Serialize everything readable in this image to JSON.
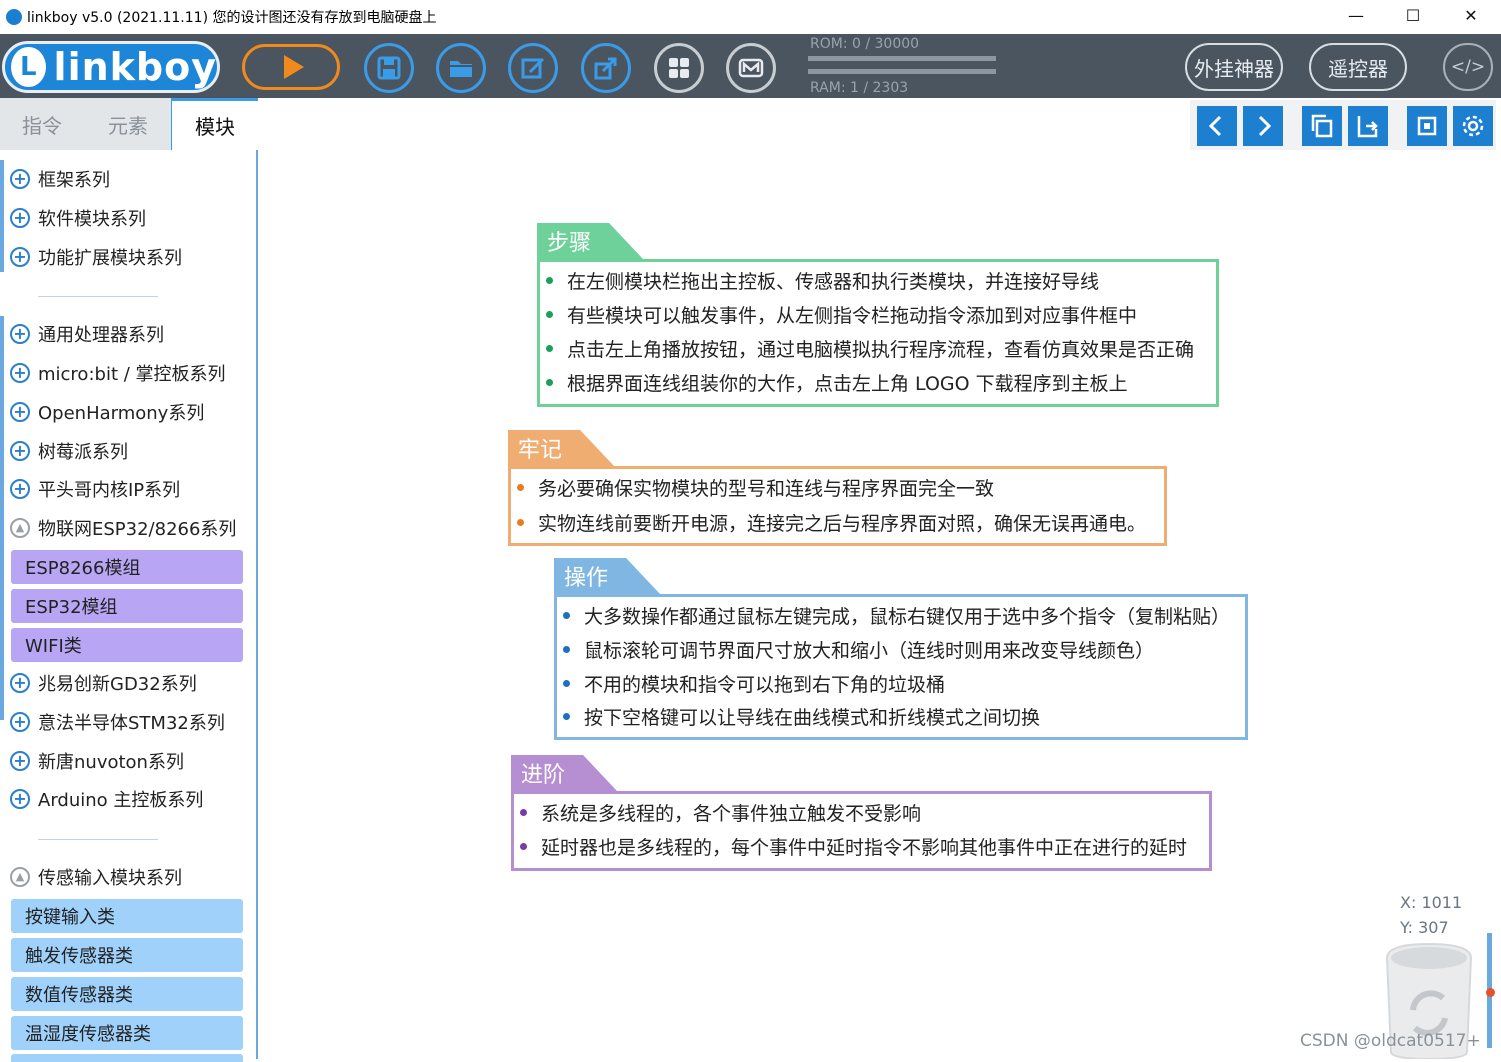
{
  "window": {
    "title": "linkboy v5.0 (2021.11.11) 您的设计图还没有存放到电脑硬盘上",
    "minimize": "—",
    "maximize": "☐",
    "close": "✕"
  },
  "toolbar": {
    "logo_text": "linkboy",
    "rom": "ROM: 0 / 30000",
    "ram": "RAM: 1 / 2303",
    "plugin_label": "外挂神器",
    "remote_label": "遥控器",
    "code_label": "</>"
  },
  "sidebar": {
    "tabs": [
      "指令",
      "元素",
      "模块"
    ],
    "active_tab": "模块",
    "groups_top": [
      "框架系列",
      "软件模块系列",
      "功能扩展模块系列"
    ],
    "groups_mid": [
      "通用处理器系列",
      "micro:bit / 掌控板系列",
      "OpenHarmony系列",
      "树莓派系列",
      "平头哥内核IP系列"
    ],
    "iot_group": "物联网ESP32/8266系列",
    "iot_subitems": [
      "ESP8266模组",
      "ESP32模组",
      "WIFI类"
    ],
    "groups_after": [
      "兆易创新GD32系列",
      "意法半导体STM32系列",
      "新唐nuvoton系列",
      "Arduino 主控板系列"
    ],
    "sensor_group": "传感输入模块系列",
    "sensor_subitems": [
      "按键输入类",
      "触发传感器类",
      "数值传感器类",
      "温湿度传感器类"
    ],
    "accent_purple": "#b8a6f5",
    "accent_blue": "#9fd1fb"
  },
  "notes": [
    {
      "title": "步骤",
      "color": "#6fd19a",
      "dot": "#1aa05a",
      "lines": [
        "在左侧模块栏拖出主控板、传感器和执行类模块，并连接好导线",
        "有些模块可以触发事件，从左侧指令栏拖动指令添加到对应事件框中",
        "点击左上角播放按钮，通过电脑模拟执行程序流程，查看仿真效果是否正确",
        "根据界面连线组装你的大作，点击左上角 LOGO 下载程序到主板上"
      ]
    },
    {
      "title": "牢记",
      "color": "#f0ad72",
      "dot": "#e87d1e",
      "lines": [
        "务必要确保实物模块的型号和连线与程序界面完全一致",
        "实物连线前要断开电源，连接完之后与程序界面对照，确保无误再通电。"
      ]
    },
    {
      "title": "操作",
      "color": "#7fb6e2",
      "dot": "#1d6fc0",
      "lines": [
        "大多数操作都通过鼠标左键完成，鼠标右键仅用于选中多个指令（复制粘贴）",
        "鼠标滚轮可调节界面尺寸放大和缩小（连线时则用来改变导线颜色）",
        "不用的模块和指令可以拖到右下角的垃圾桶",
        "按下空格键可以让导线在曲线模式和折线模式之间切换"
      ]
    },
    {
      "title": "进阶",
      "color": "#b68fd3",
      "dot": "#7a3aa8",
      "lines": [
        "系统是多线程的，各个事件独立触发不受影响",
        "延时器也是多线程的，每个事件中延时指令不影响其他事件中正在进行的延时"
      ]
    }
  ],
  "coords": {
    "x": "X: 1011",
    "y": "Y: 307"
  },
  "watermark": "CSDN @oldcat0517+"
}
